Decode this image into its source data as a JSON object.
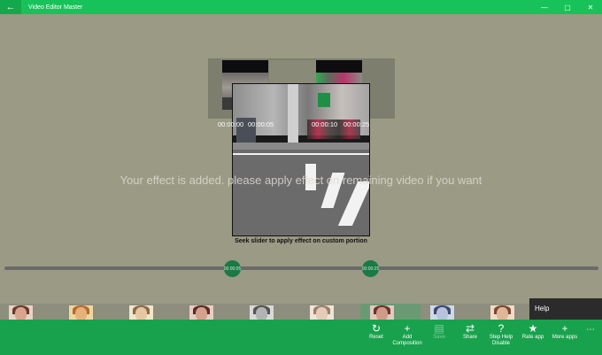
{
  "window": {
    "title": "Video Editor Master",
    "back_icon": "arrow-left-icon",
    "controls": {
      "minimize": "—",
      "maximize": "▢",
      "close": "✕"
    }
  },
  "timeline": {
    "timestamps": [
      "00:00:00",
      "00:00:05",
      "00:00:10",
      "00:00:25"
    ]
  },
  "status_message": "Your effect is added. please apply effect on remaining video if you want",
  "seek_hint": "Seek slider to apply effect on custom portion",
  "slider": {
    "start_label": "00:00:05",
    "end_label": "00:00:25"
  },
  "effects": {
    "count": 9,
    "selected_index": 6
  },
  "help_panel": {
    "label": "Help"
  },
  "commands": [
    {
      "label": "Reset",
      "icon": "reset-icon",
      "enabled": true
    },
    {
      "label": "Add Composition",
      "icon": "plus-icon",
      "enabled": true
    },
    {
      "label": "Save",
      "icon": "save-icon",
      "enabled": false
    },
    {
      "label": "Share",
      "icon": "share-icon",
      "enabled": true
    },
    {
      "label": "Step Help Disable",
      "icon": "question-icon",
      "enabled": true
    },
    {
      "label": "Rate app",
      "icon": "star-icon",
      "enabled": true
    },
    {
      "label": "More apps",
      "icon": "plus-icon",
      "enabled": true
    }
  ],
  "colors": {
    "accent": "#18a24d",
    "titlebar": "#17c25a",
    "canvas": "#9a9a85",
    "slider_knob": "#1a7a45"
  }
}
